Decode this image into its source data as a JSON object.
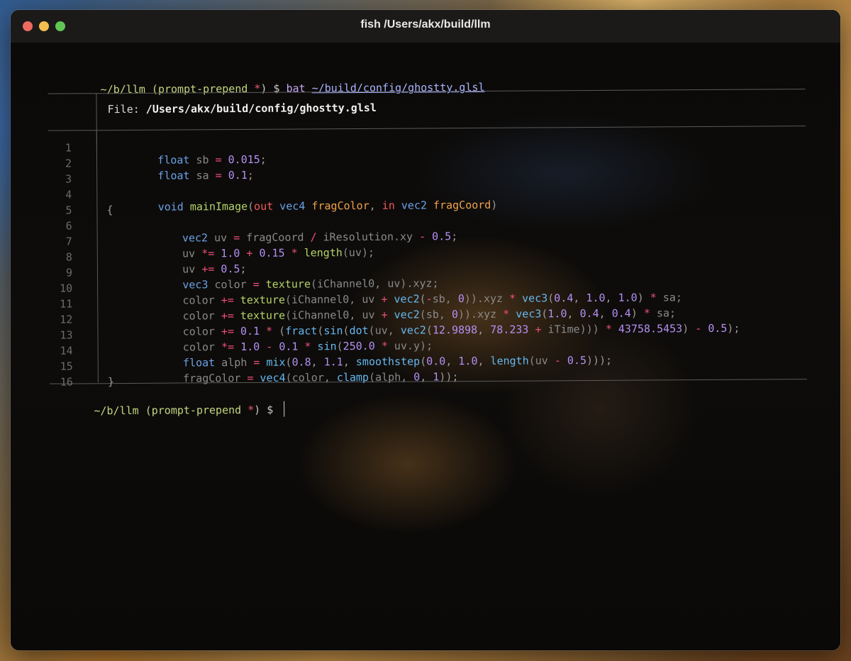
{
  "window": {
    "title": "fish  /Users/akx/build/llm"
  },
  "prompt": {
    "path": "~/b/llm",
    "branch_open": " (prompt-prepend ",
    "star": "*",
    "branch_close": ") $ ",
    "command": "bat",
    "argument": "~/build/config/ghostty.glsl"
  },
  "bat": {
    "file_label": "File: ",
    "file_path": "/Users/akx/build/config/ghostty.glsl",
    "line_numbers": [
      "1",
      "2",
      "3",
      "4",
      "5",
      "6",
      "7",
      "8",
      "9",
      "10",
      "11",
      "12",
      "13",
      "14",
      "15",
      "16"
    ]
  },
  "code": {
    "l1": [
      "float",
      " sb ",
      "=",
      " ",
      "0.015",
      ";"
    ],
    "l2": [
      "float",
      " sa ",
      "=",
      " ",
      "0.1",
      ";"
    ],
    "l4": [
      "void",
      " ",
      "mainImage",
      "(",
      "out",
      " ",
      "vec4",
      " ",
      "fragColor",
      ", ",
      "in",
      " ",
      "vec2",
      " ",
      "fragCoord",
      ")"
    ],
    "l5": "{",
    "l6": [
      "vec2",
      " uv ",
      "=",
      " fragCoord ",
      "/",
      " iResolution.xy ",
      "-",
      " ",
      "0.5",
      ";"
    ],
    "l7": [
      "uv ",
      "*=",
      " ",
      "1.0",
      " ",
      "+",
      " ",
      "0.15",
      " ",
      "*",
      " ",
      "length",
      "(uv);"
    ],
    "l8": [
      "uv ",
      "+=",
      " ",
      "0.5",
      ";"
    ],
    "l9": [
      "vec3",
      " color ",
      "=",
      " ",
      "texture",
      "(iChannel0, uv).xyz;"
    ],
    "l10": [
      "color ",
      "+=",
      " ",
      "texture",
      "(iChannel0, uv ",
      "+",
      " ",
      "vec2",
      "(",
      "-",
      "sb, ",
      "0",
      ")).xyz ",
      "*",
      " ",
      "vec3",
      "(",
      "0.4",
      ", ",
      "1.0",
      ", ",
      "1.0",
      ") ",
      "*",
      " sa;"
    ],
    "l11": [
      "color ",
      "+=",
      " ",
      "texture",
      "(iChannel0, uv ",
      "+",
      " ",
      "vec2",
      "(sb, ",
      "0",
      ")).xyz ",
      "*",
      " ",
      "vec3",
      "(",
      "1.0",
      ", ",
      "0.4",
      ", ",
      "0.4",
      ") ",
      "*",
      " sa;"
    ],
    "l12": [
      "color ",
      "+=",
      " ",
      "0.1",
      " ",
      "*",
      " (",
      "fract",
      "(",
      "sin",
      "(",
      "dot",
      "(uv, ",
      "vec2",
      "(",
      "12.9898",
      ", ",
      "78.233",
      " ",
      "+",
      " iTime))) ",
      "*",
      " ",
      "43758.5453",
      ") ",
      "-",
      " ",
      "0.5",
      ");"
    ],
    "l13": [
      "color ",
      "*=",
      " ",
      "1.0",
      " ",
      "-",
      " ",
      "0.1",
      " ",
      "*",
      " ",
      "sin",
      "(",
      "250.0",
      " ",
      "*",
      " uv.y);"
    ],
    "l14": [
      "float",
      " alph ",
      "=",
      " ",
      "mix",
      "(",
      "0.8",
      ", ",
      "1.1",
      ", ",
      "smoothstep",
      "(",
      "0.0",
      ", ",
      "1.0",
      ", ",
      "length",
      "(uv ",
      "-",
      " ",
      "0.5",
      ")));"
    ],
    "l15": [
      "fragColor ",
      "=",
      " ",
      "vec4",
      "(color, ",
      "clamp",
      "(alph, ",
      "0",
      ", ",
      "1",
      "));"
    ],
    "l16": "}"
  },
  "colors": {
    "type": "#6aa2e8",
    "keyword": "#ef5a5a",
    "function": "#b3d46a",
    "parameter": "#f0a24a",
    "operator": "#ef4f7a",
    "number": "#b490f5",
    "prompt_path": "#c3d77f",
    "prompt_command": "#c7a6f0"
  }
}
